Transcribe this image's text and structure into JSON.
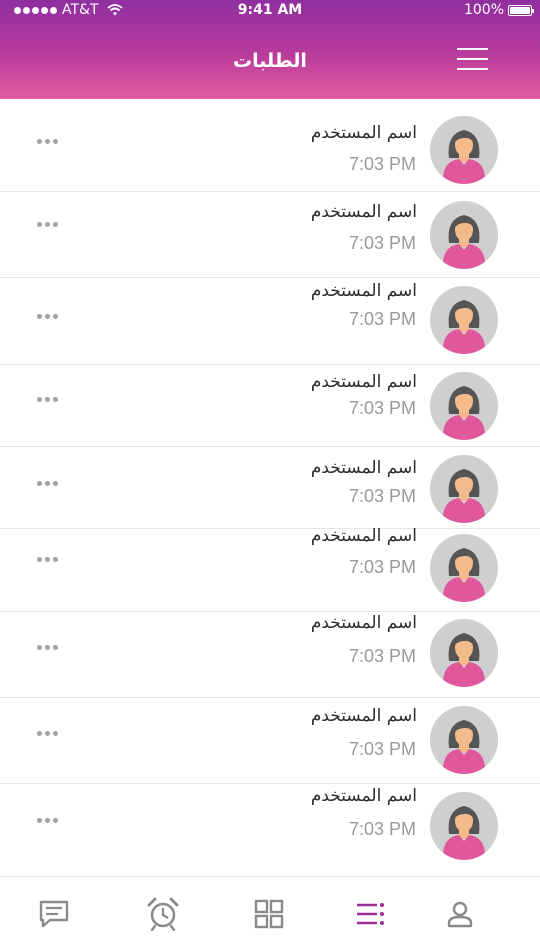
{
  "status_bar": {
    "carrier": "AT&T",
    "time": "9:41 AM",
    "battery": "100%"
  },
  "header": {
    "title": "الطلبات"
  },
  "requests": [
    {
      "user_name": "اسم المستخدم",
      "time": "7:03 PM"
    },
    {
      "user_name": "اسم المستخدم",
      "time": "7:03 PM"
    },
    {
      "user_name": "اسم المستخدم",
      "time": "7:03 PM"
    },
    {
      "user_name": "اسم المستخدم",
      "time": "7:03 PM"
    },
    {
      "user_name": "اسم المستخدم",
      "time": "7:03 PM"
    },
    {
      "user_name": "اسم المستخدم",
      "time": "7:03 PM"
    },
    {
      "user_name": "اسم المستخدم",
      "time": "7:03 PM"
    },
    {
      "user_name": "اسم المستخدم",
      "time": "7:03 PM"
    },
    {
      "user_name": "اسم المستخدم",
      "time": "7:03 PM"
    }
  ],
  "tab_bar": {
    "tabs": [
      {
        "icon": "message-icon",
        "active": false
      },
      {
        "icon": "alarm-clock-icon",
        "active": false
      },
      {
        "icon": "grid-icon",
        "active": false
      },
      {
        "icon": "list-icon",
        "active": true
      },
      {
        "icon": "user-icon",
        "active": false
      }
    ]
  },
  "colors": {
    "header_gradient_top": "#8f2fa0",
    "header_gradient_bottom": "#e35c9e",
    "accent": "#9a2f98",
    "inactive_icon": "#8a8a8a",
    "avatar_shirt": "#e0579c",
    "avatar_skin": "#f3bb8c",
    "avatar_hair": "#555555"
  }
}
